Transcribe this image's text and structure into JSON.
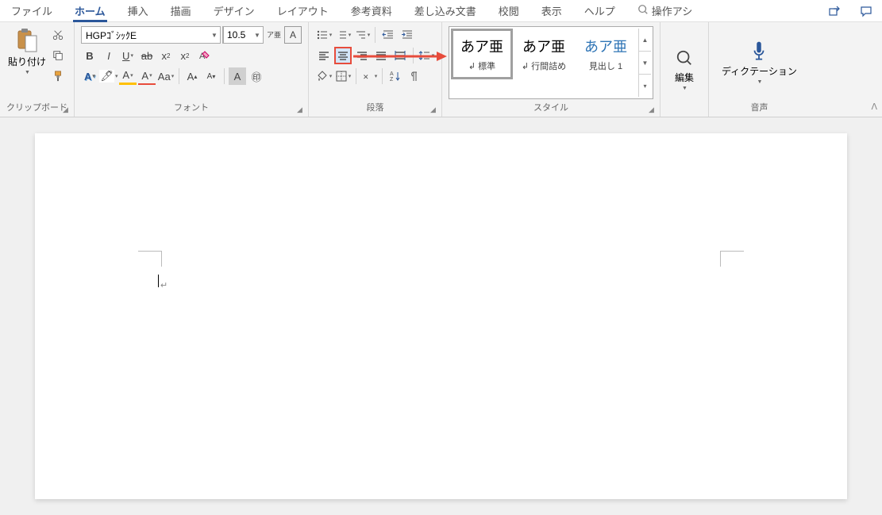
{
  "tabs": {
    "file": "ファイル",
    "home": "ホーム",
    "insert": "挿入",
    "draw": "描画",
    "design": "デザイン",
    "layout": "レイアウト",
    "references": "参考資料",
    "mailings": "差し込み文書",
    "review": "校閲",
    "view": "表示",
    "help": "ヘルプ",
    "search": "操作アシ"
  },
  "groups": {
    "clipboard": "クリップボード",
    "font": "フォント",
    "paragraph": "段落",
    "styles": "スタイル",
    "editing_label": "編集",
    "voice": "音声"
  },
  "clipboard": {
    "paste": "貼り付け"
  },
  "font": {
    "name": "HGPｺﾞｼｯｸE",
    "size": "10.5",
    "ruby": "ア亜",
    "charbox": "A"
  },
  "styles": {
    "preview": "あア亜",
    "normal": "標準",
    "nospace": "行間詰め",
    "heading1": "見出し 1"
  },
  "editing": {
    "label": "編集"
  },
  "dictation": {
    "label": "ディクテーション"
  },
  "doc": {
    "para_mark": "↵"
  }
}
